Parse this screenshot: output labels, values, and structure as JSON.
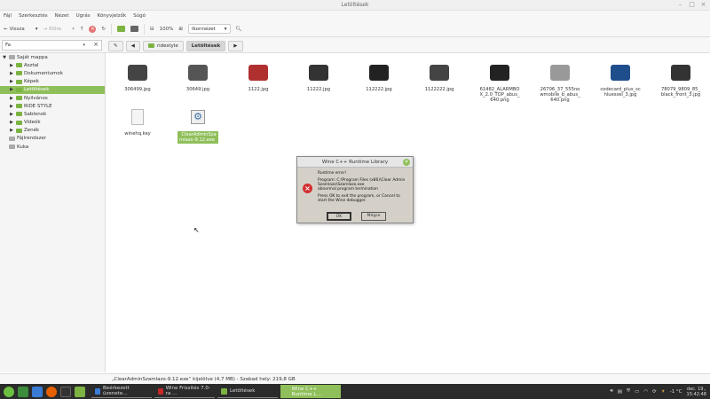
{
  "window": {
    "title": "Letöltések"
  },
  "menu": [
    "Fájl",
    "Szerkesztés",
    "Nézet",
    "Ugrás",
    "Könyvjelzők",
    "Súgó"
  ],
  "toolbar": {
    "back": "Vissza",
    "forward": "Előre",
    "zoom": "100%",
    "view_mode": "Ikonnézet"
  },
  "location": {
    "value": "Fa"
  },
  "breadcrumb": [
    "ridestyle",
    "Letöltések"
  ],
  "sidebar": [
    {
      "label": "Saját mappa",
      "level": 0,
      "expanded": true
    },
    {
      "label": "Asztal",
      "level": 1
    },
    {
      "label": "Dokumentumok",
      "level": 1
    },
    {
      "label": "Képek",
      "level": 1
    },
    {
      "label": "Letöltések",
      "level": 1,
      "selected": true
    },
    {
      "label": "Nyilvános",
      "level": 1
    },
    {
      "label": "RIDE STYLE",
      "level": 1
    },
    {
      "label": "Sablonok",
      "level": 1
    },
    {
      "label": "Videók",
      "level": 1
    },
    {
      "label": "Zenék",
      "level": 1
    },
    {
      "label": "Fájlrendszer",
      "level": 0
    },
    {
      "label": "Kuka",
      "level": 0
    }
  ],
  "files": [
    {
      "name": "306499.jpg"
    },
    {
      "name": "30649.jpg"
    },
    {
      "name": "1122.jpg"
    },
    {
      "name": "11222.jpg"
    },
    {
      "name": "112222.jpg"
    },
    {
      "name": "1122222.jpg"
    },
    {
      "name": "61482_ALARMBOX_2.0_TOP_abus_640.png"
    },
    {
      "name": "26706_37_555nowmobile_b_abus_640.png"
    },
    {
      "name": "codecard_plus_schluessel_3.jpg"
    },
    {
      "name": "78079_9809_85_black_front_3.jpg"
    },
    {
      "name": "winehq.key"
    },
    {
      "name": "ClearAdminSzamlazo-9.12.exe",
      "selected": true
    }
  ],
  "status": "„ClearAdminSzamlazo-9.12.exe” kijelölve (4,7 MB) - Szabad hely: 219,8 GB",
  "dialog": {
    "title": "Wine C++ Runtime Library",
    "line1": "Runtime error!",
    "line2": "Program: C:\\Program Files (x86)\\Clear Admin Szamlazo\\Szamlazo.exe",
    "line3": "abnormal program termination",
    "line4": "Press OK to exit the program, or Cancel to start the Wine debugger.",
    "ok": "OK",
    "cancel": "Mégse"
  },
  "taskbar": {
    "tasks": [
      {
        "label": "Beérkezett üzenete…"
      },
      {
        "label": "Wine Frissítés 7.0-ra …"
      },
      {
        "label": "Letöltések"
      },
      {
        "label": "Wine C++ Runtime L…",
        "active": true
      }
    ],
    "temp": "-1 °C",
    "date": "dec. 19.,",
    "time": "15:42:48"
  },
  "colors": {
    "accent": "#8fbf5a",
    "taskbar": "#2b2b2b",
    "error": "#d32f2f"
  }
}
